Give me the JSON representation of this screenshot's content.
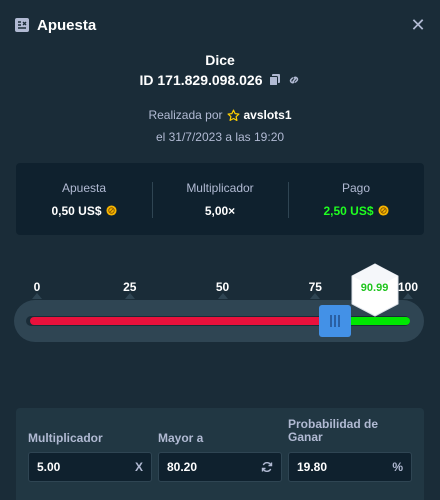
{
  "modal": {
    "title": "Apuesta",
    "title_icon": "bet-slip-icon",
    "close_icon": "close-icon"
  },
  "bet": {
    "game": "Dice",
    "id_text": "ID 171.829.098.026",
    "placed_by_prefix": "Realizada por",
    "user_icon": "star-icon",
    "username": "avslots1",
    "placed_on": "el 31/7/2023 a las 19:20"
  },
  "stats": {
    "bet_label": "Apuesta",
    "bet_value": "0,50 US$",
    "multiplier_label": "Multiplicador",
    "multiplier_value": "5,00×",
    "payout_label": "Pago",
    "payout_value": "2,50 US$",
    "currency_icon": "coin-icon"
  },
  "slider": {
    "ticks": [
      "0",
      "25",
      "50",
      "75",
      "100"
    ],
    "roll_over": 80.2,
    "result": "90.99",
    "result_value": 90.99,
    "colors": {
      "lose": "#e9113c",
      "win": "#00e701",
      "handle": "#4391e7",
      "result_text": "#1fc41f"
    }
  },
  "fields": {
    "multiplier": {
      "label": "Multiplicador",
      "value": "5.00",
      "suffix": "X"
    },
    "roll_over": {
      "label": "Mayor a",
      "value": "80.20",
      "suffix_icon": "refresh-icon"
    },
    "win_chance": {
      "label": "Probabilidad de Ganar",
      "value": "19.80",
      "suffix": "%"
    }
  }
}
